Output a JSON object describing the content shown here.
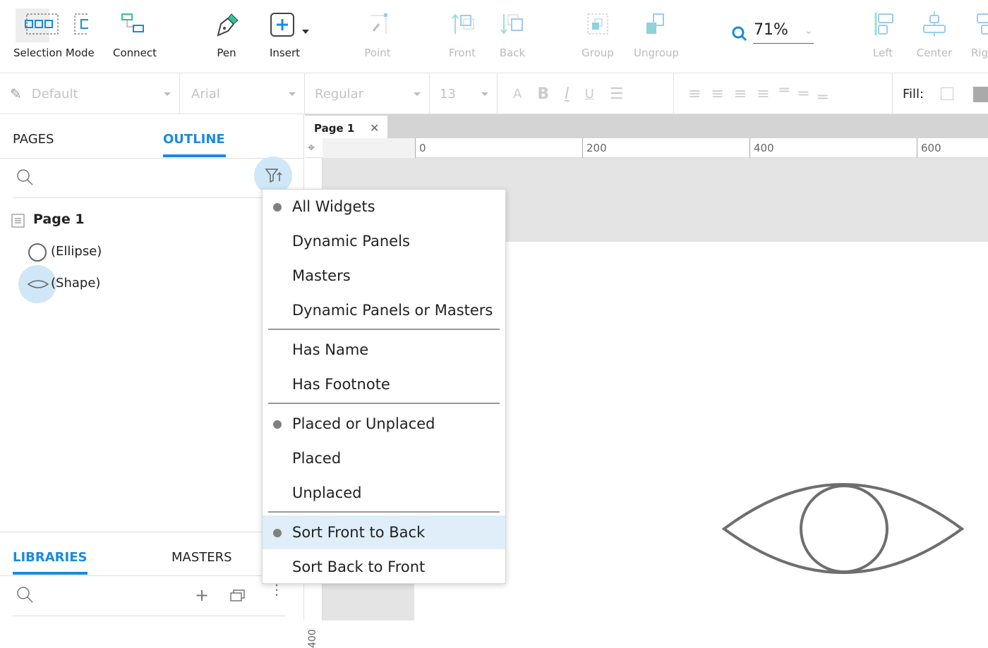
{
  "toolbar": {
    "tools": [
      {
        "label": "Selection Mode",
        "icon": "selection-mode-icon",
        "enabled": true
      },
      {
        "label": "Connect",
        "icon": "connect-icon",
        "enabled": true
      },
      {
        "label": "Pen",
        "icon": "pen-icon",
        "enabled": true
      },
      {
        "label": "Insert",
        "icon": "insert-icon",
        "enabled": true
      },
      {
        "label": "Point",
        "icon": "point-icon",
        "enabled": false
      },
      {
        "label": "Front",
        "icon": "bring-front-icon",
        "enabled": false
      },
      {
        "label": "Back",
        "icon": "send-back-icon",
        "enabled": false
      },
      {
        "label": "Group",
        "icon": "group-icon",
        "enabled": false
      },
      {
        "label": "Ungroup",
        "icon": "ungroup-icon",
        "enabled": false
      },
      {
        "label": "Left",
        "icon": "align-left-icon",
        "enabled": false
      },
      {
        "label": "Center",
        "icon": "align-center-icon",
        "enabled": false
      },
      {
        "label": "Rig",
        "icon": "align-right-icon",
        "enabled": false
      }
    ],
    "zoom": "71%"
  },
  "format": {
    "style": "Default",
    "font": "Arial",
    "weight": "Regular",
    "size": "13",
    "fill_label": "Fill:"
  },
  "left_panel": {
    "tabs": [
      "PAGES",
      "OUTLINE"
    ],
    "active_tab": "OUTLINE",
    "tree": {
      "page": "Page 1",
      "items": [
        "(Ellipse)",
        "(Shape)"
      ]
    },
    "bottom_tabs": [
      "LIBRARIES",
      "MASTERS"
    ],
    "bottom_active": "LIBRARIES"
  },
  "canvas": {
    "tab": "Page 1",
    "ruler_labels": [
      "0",
      "200",
      "400",
      "600"
    ],
    "vruler_label": "400"
  },
  "filter_menu": {
    "groups": [
      [
        {
          "label": "All Widgets",
          "checked": true
        },
        {
          "label": "Dynamic Panels"
        },
        {
          "label": "Masters"
        },
        {
          "label": "Dynamic Panels or Masters"
        }
      ],
      [
        {
          "label": "Has Name"
        },
        {
          "label": "Has Footnote"
        }
      ],
      [
        {
          "label": "Placed or Unplaced",
          "checked": true
        },
        {
          "label": "Placed"
        },
        {
          "label": "Unplaced"
        }
      ],
      [
        {
          "label": "Sort Front to Back",
          "checked": true,
          "highlighted": true
        },
        {
          "label": "Sort Back to Front"
        }
      ]
    ]
  },
  "colors": {
    "accent": "#1a8ae0",
    "teal": "#2ec4a0",
    "highlight": "#dfeef8"
  }
}
